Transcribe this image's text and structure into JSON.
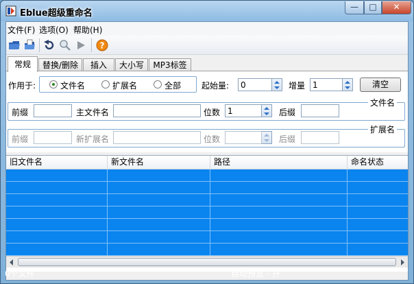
{
  "window": {
    "title": "Eblue超级重命名",
    "min_glyph": "—",
    "max_glyph": "□",
    "close_glyph": "✕"
  },
  "menu": [
    "文件(F)",
    "选项(O)",
    "帮助(H)"
  ],
  "toolbar": [
    "open-folder-icon",
    "open-file-icon",
    "undo-icon",
    "search-icon",
    "play-icon",
    "help-icon"
  ],
  "tabs": [
    "常规",
    "替换/删除",
    "插入",
    "大小写",
    "MP3标签"
  ],
  "general": {
    "apply_label": "作用于:",
    "options": [
      "文件名",
      "扩展名",
      "全部"
    ],
    "selected": "文件名",
    "start_label": "起始量:",
    "start_value": "0",
    "inc_label": "增量",
    "inc_value": "1",
    "clear_button": "清空"
  },
  "filename_group": {
    "title": "文件名",
    "prefix_label": "前缀",
    "main_label": "主文件名",
    "digits_label": "位数",
    "digits_value": "1",
    "suffix_label": "后缀"
  },
  "ext_group": {
    "title": "扩展名",
    "prefix_label": "前缀",
    "new_ext_label": "新扩展名",
    "digits_label": "位数",
    "suffix_label": "后缀"
  },
  "list": {
    "columns": [
      "旧文件名",
      "新文件名",
      "路径",
      "命名状态"
    ]
  },
  "status": {
    "count": "0个文件",
    "preview": "自动预览 - 开"
  },
  "colors": {
    "selection": "#0a84ee",
    "accent": "#2a6fc4"
  }
}
